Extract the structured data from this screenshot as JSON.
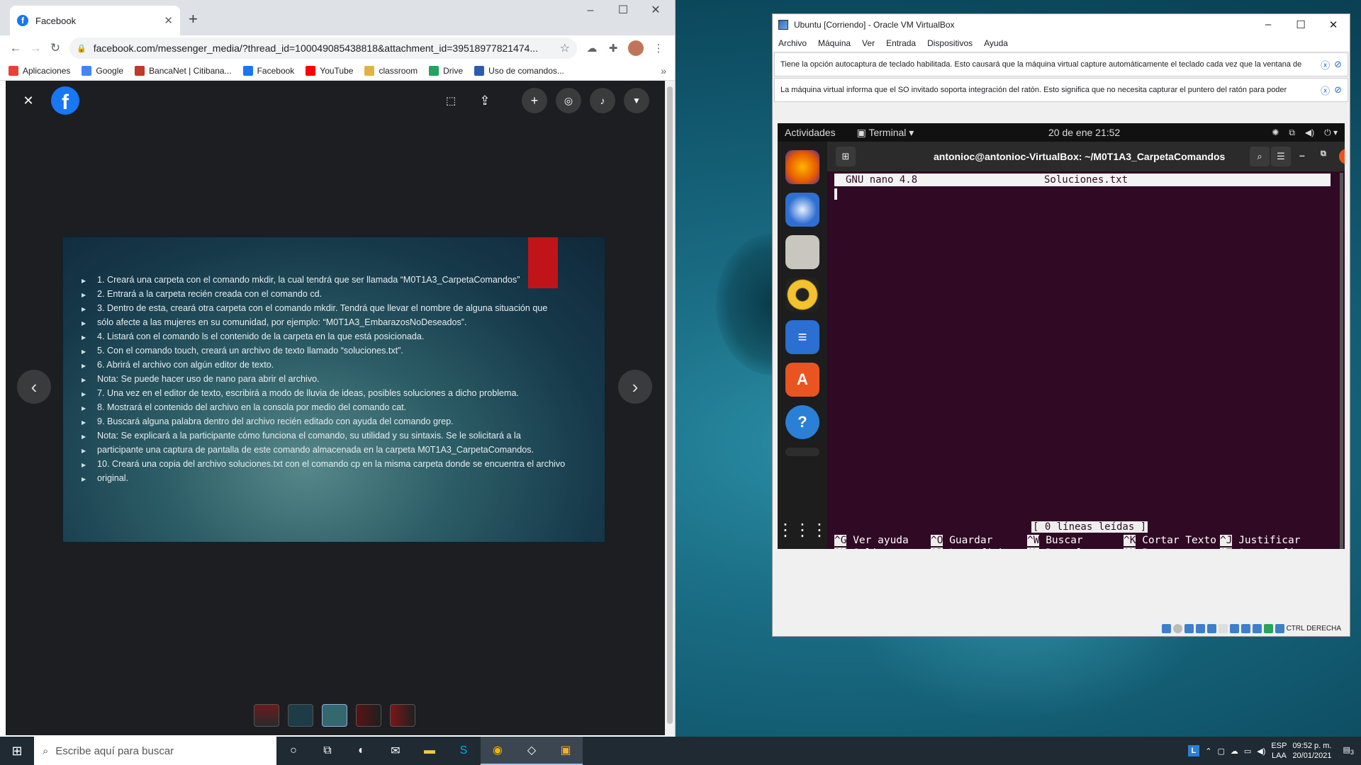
{
  "chrome": {
    "tab_title": "Facebook",
    "url": "facebook.com/messenger_media/?thread_id=100049085438818&attachment_id=39518977821474...",
    "bookmarks": [
      {
        "label": "Aplicaciones",
        "color": "#e94235"
      },
      {
        "label": "Google",
        "color": "#4285f4"
      },
      {
        "label": "BancaNet | Citibana...",
        "color": "#c0392b"
      },
      {
        "label": "Facebook",
        "color": "#1877f2"
      },
      {
        "label": "YouTube",
        "color": "#ff0000"
      },
      {
        "label": "classroom",
        "color": "#e2b33f"
      },
      {
        "label": "Drive",
        "color": "#1fa463"
      },
      {
        "label": "Uso de comandos...",
        "color": "#2a5db0"
      }
    ],
    "slide_items": [
      "1. Creará una carpeta con el comando mkdir, la cual tendrá que ser llamada “M0T1A3_CarpetaComandos”",
      "2. Entrará a la carpeta recién creada con el comando cd.",
      "3. Dentro de esta, creará otra carpeta con el comando mkdir. Tendrá que llevar el nombre de alguna situación que",
      "sólo afecte a las mujeres en su comunidad, por ejemplo: “M0T1A3_EmbarazosNoDeseados”.",
      "4. Listará con el comando ls el contenido de la carpeta en la que está posicionada.",
      "5. Con el comando touch, creará un archivo de texto llamado “soluciones.txt”.",
      "6. Abrirá el archivo con algún editor de texto.",
      "Nota: Se puede hacer uso de nano para abrir el archivo.",
      "7. Una vez en el editor de texto, escribirá a modo de lluvia de ideas, posibles soluciones a dicho problema.",
      "8. Mostrará el contenido del archivo en la consola por medio del comando cat.",
      "9. Buscará alguna palabra dentro del archivo recién editado con ayuda del comando grep.",
      "Nota: Se explicará a la participante cómo funciona el comando, su utilidad y su sintaxis. Se le solicitará a la",
      "participante una captura de pantalla de este comando almacenada en la carpeta M0T1A3_CarpetaComandos.",
      "10. Creará una copia del archivo soluciones.txt con el comando cp en la misma carpeta donde se encuentra el archivo",
      "original."
    ]
  },
  "vbox": {
    "title": "Ubuntu [Corriendo] - Oracle VM VirtualBox",
    "menu": [
      "Archivo",
      "Máquina",
      "Ver",
      "Entrada",
      "Dispositivos",
      "Ayuda"
    ],
    "notice1": "Tiene la opción autocaptura de teclado habilitada. Esto causará que la máquina virtual capture automáticamente el teclado cada vez que la ventana de",
    "notice2": "La máquina virtual informa que el SO invitado soporta integración del ratón. Esto significa que no necesita capturar el puntero del ratón para poder",
    "status_key": "CTRL DERECHA"
  },
  "ubuntu": {
    "activities": "Actividades",
    "app_menu": "Terminal",
    "datetime": "20 de ene  21:52",
    "terminal_title": "antonioc@antonioc-VirtualBox: ~/M0T1A3_CarpetaComandos",
    "nano_version": "GNU nano 4.8",
    "nano_file": "Soluciones.txt",
    "status_msg": "[ 0 líneas leídas ]",
    "help_row1": [
      {
        "key": "^G",
        "label": "Ver ayuda"
      },
      {
        "key": "^O",
        "label": "Guardar"
      },
      {
        "key": "^W",
        "label": "Buscar"
      },
      {
        "key": "^K",
        "label": "Cortar Texto"
      },
      {
        "key": "^J",
        "label": "Justificar"
      }
    ],
    "help_row2": [
      {
        "key": "^X",
        "label": "Salir"
      },
      {
        "key": "^R",
        "label": "Leer fich."
      },
      {
        "key": "^\\",
        "label": "Reemplazar"
      },
      {
        "key": "^U",
        "label": "Pegar"
      },
      {
        "key": "^T",
        "label": "Ortografía"
      }
    ]
  },
  "taskbar": {
    "search_placeholder": "Escribe aquí para buscar",
    "lang": "ESP",
    "lang2": "LAA",
    "time": "09:52 p. m.",
    "date": "20/01/2021",
    "notif_count": "3"
  }
}
